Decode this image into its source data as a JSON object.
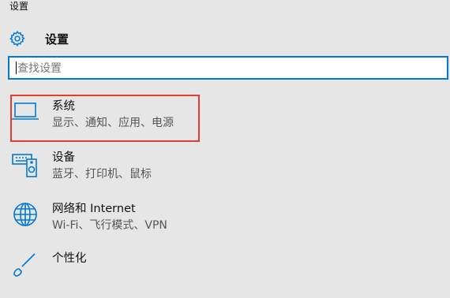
{
  "window": {
    "title": "设置"
  },
  "header": {
    "title": "设置",
    "icon": "gear-icon"
  },
  "search": {
    "placeholder": "查找设置",
    "value": ""
  },
  "categories": [
    {
      "label": "系统",
      "description": "显示、通知、应用、电源",
      "icon": "laptop-icon"
    },
    {
      "label": "设备",
      "description": "蓝牙、打印机、鼠标",
      "icon": "devices-icon"
    },
    {
      "label": "网络和 Internet",
      "description": "Wi-Fi、飞行模式、VPN",
      "icon": "globe-icon"
    },
    {
      "label": "个性化",
      "description": "",
      "icon": "brush-icon"
    }
  ],
  "colors": {
    "accent": "#0078d7",
    "highlight": "#e53935",
    "background": "#e6e6e6"
  }
}
